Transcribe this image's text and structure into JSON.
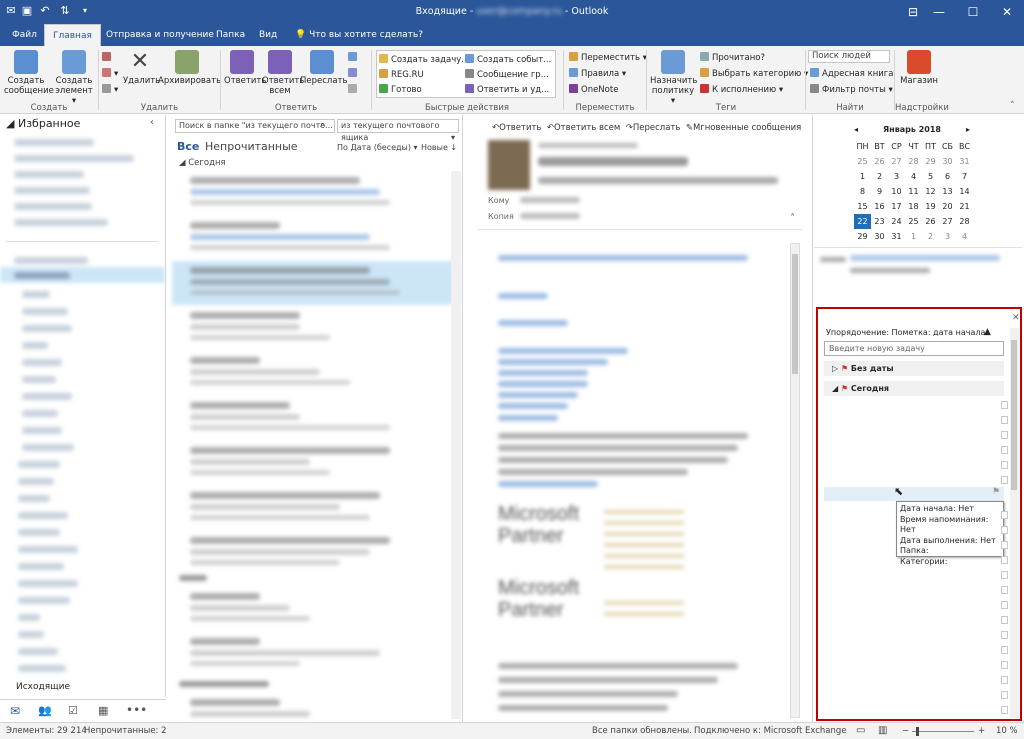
{
  "titlebar": {
    "title_left": "Входящие - ",
    "title_right": " - Outlook",
    "account_blurred": "user@company.ru"
  },
  "tabs": [
    "Файл",
    "Главная",
    "Отправка и получение",
    "Папка",
    "Вид",
    "Что вы хотите сделать?"
  ],
  "ribbon": {
    "new_email": "Создать сообщение",
    "new_items": "Создать элемент",
    "delete": "Удалить",
    "archive": "Архивировать",
    "reply": "Ответить",
    "reply_all": "Ответить всем",
    "forward": "Переслать",
    "qs_items": [
      "Создать задачу...",
      "REG.RU",
      "Готово",
      "Создать событ...",
      "Сообщение гр...",
      "Ответить и уд..."
    ],
    "move": "Переместить",
    "rules": "Правила",
    "onenote": "OneNote",
    "assign_policy": "Назначить политику",
    "read_unread": "Прочитано?",
    "categorize": "Выбрать категорию",
    "follow_up": "К исполнению",
    "search_people": "Поиск людей",
    "address_book": "Адресная книга",
    "filter_email": "Фильтр почты",
    "store": "Магазин",
    "groups": [
      "Создать",
      "Удалить",
      "Ответить",
      "Быстрые действия",
      "Переместить",
      "Теги",
      "Найти",
      "Надстройки"
    ]
  },
  "nav": {
    "favorites": "Избранное",
    "outbox": "Исходящие"
  },
  "list": {
    "search_placeholder": "Поиск в папке \"из текущего почто...",
    "scope": "из текущего почтового ящика",
    "tab_all": "Все",
    "tab_unread": "Непрочитанные",
    "sort_by": "По Дата (беседы)",
    "order": "Новые",
    "group_today": "Сегодня",
    "group_yesterday": "Вчера",
    "group_lastweek": "На прошлой неделе"
  },
  "reading": {
    "reply": "Ответить",
    "reply_all": "Ответить всем",
    "forward": "Переслать",
    "im": "Мгновенные сообщения",
    "to_label": "Кому",
    "cc_label": "Копия",
    "partner_text": "Microsoft Partner"
  },
  "calendar": {
    "month": "Январь 2018",
    "weekdays": [
      "ПН",
      "ВТ",
      "СР",
      "ЧТ",
      "ПТ",
      "СБ",
      "ВС"
    ],
    "weeks": [
      [
        "25",
        "26",
        "27",
        "28",
        "29",
        "30",
        "31"
      ],
      [
        "1",
        "2",
        "3",
        "4",
        "5",
        "6",
        "7"
      ],
      [
        "8",
        "9",
        "10",
        "11",
        "12",
        "13",
        "14"
      ],
      [
        "15",
        "16",
        "17",
        "18",
        "19",
        "20",
        "21"
      ],
      [
        "22",
        "23",
        "24",
        "25",
        "26",
        "27",
        "28"
      ],
      [
        "29",
        "30",
        "31",
        "1",
        "2",
        "3",
        "4"
      ]
    ],
    "today": "22"
  },
  "tasks": {
    "arrange": "Упорядочение: Пометка: дата начала",
    "new_task_placeholder": "Введите новую задачу",
    "group_nodate": "Без даты",
    "group_today": "Сегодня",
    "tooltip": [
      "Дата начала: Нет",
      "Время напоминания: Нет",
      "Дата выполнения: Нет",
      "Папка:",
      "Категории:"
    ]
  },
  "status": {
    "items": "Элементы: 29 214",
    "unread": "Непрочитанные: 2",
    "updated": "Все папки обновлены.",
    "connected": "Подключено к: Microsoft Exchange",
    "zoom": "10 %"
  },
  "colors": {
    "accent": "#2b579a",
    "selected": "#cde6f7",
    "highlight_box": "#c00000",
    "today_bg": "#1f6fb8"
  }
}
